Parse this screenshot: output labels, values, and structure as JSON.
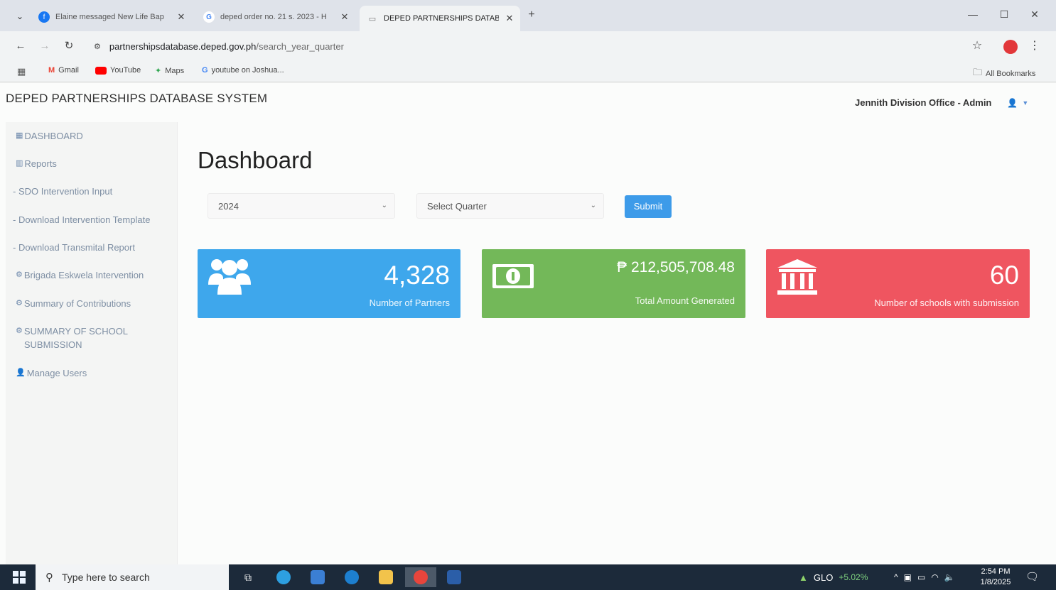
{
  "browser": {
    "tabs": [
      {
        "label": "Elaine messaged New Life Bap",
        "icon_color": "#1877f2",
        "icon": "f"
      },
      {
        "label": "deped order no. 21 s. 2023 - H",
        "icon_color": "#4285f4",
        "icon": "G"
      },
      {
        "label": "DEPED PARTNERSHIPS DATABA",
        "icon_color": "#9aa0a6",
        "icon": "▭"
      }
    ],
    "url_host": "partnershipsdatabase.deped.gov.ph",
    "url_path": "/search_year_quarter",
    "bookmarks": [
      {
        "label": "Gmail"
      },
      {
        "label": "YouTube"
      },
      {
        "label": "Maps"
      },
      {
        "label": "youtube on Joshua..."
      }
    ],
    "all_bookmarks_label": "All Bookmarks"
  },
  "app": {
    "title": "DEPED PARTNERSHIPS DATABASE SYSTEM",
    "user_label": "Jennith Division Office - Admin"
  },
  "sidebar": {
    "items": [
      {
        "label": "DASHBOARD",
        "icon": "▦"
      },
      {
        "label": "Reports",
        "icon": "📊"
      },
      {
        "label": "- SDO Intervention Input"
      },
      {
        "label": "- Download Intervention Template"
      },
      {
        "label": "- Download Transmital Report"
      },
      {
        "label": "Brigada Eskwela Intervention",
        "icon": "⚙"
      },
      {
        "label": "Summary of Contributions",
        "icon": "⚙"
      },
      {
        "label": "SUMMARY OF SCHOOL SUBMISSION",
        "icon": "⚙"
      },
      {
        "label": "Manage Users",
        "icon": "👤"
      }
    ]
  },
  "main": {
    "title": "Dashboard",
    "year_select": "2024",
    "quarter_select": "Select Quarter",
    "submit_label": "Submit"
  },
  "cards": [
    {
      "value": "4,328",
      "label": "Number of Partners",
      "color": "#3ea7ec"
    },
    {
      "value": "₱ 212,505,708.48",
      "label": "Total Amount Generated",
      "color": "#73b859"
    },
    {
      "value": "60",
      "label": "Number of schools with submission",
      "color": "#ef5560"
    }
  ],
  "taskbar": {
    "search_placeholder": "Type here to search",
    "tray_carrier": "GLO",
    "tray_change": "+5.02%",
    "time": "2:54 PM",
    "date": "1/8/2025"
  }
}
